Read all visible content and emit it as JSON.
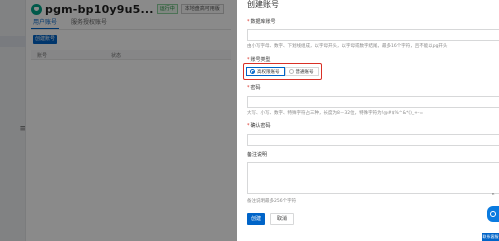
{
  "background": {
    "instance_title": "pgm-bp10y9u5...",
    "status_badge": "运行中",
    "tag_badge": "本地盘高可用版",
    "tabs": [
      {
        "label": "用户账号",
        "active": true
      },
      {
        "label": "服务授权账号",
        "active": false
      }
    ],
    "create_button": "创建账号",
    "table_headers": [
      "账号",
      "状态"
    ],
    "side_glyph": "≡"
  },
  "drawer": {
    "title": "创建账号",
    "account_name": {
      "label": "数据库账号",
      "placeholder": "",
      "help": "由小写字母、数字、下划线组成，以字母开头，以字母或数字结尾，最多16个字符，且不能以pg开头"
    },
    "account_type": {
      "label": "账号类型",
      "options": [
        {
          "label": "高权限账号",
          "selected": true
        },
        {
          "label": "普通账号",
          "selected": false
        }
      ]
    },
    "password": {
      "label": "密码",
      "help": "大写、小写、数字、特殊字符占三种，长度为8－32位，特殊字符为!@#$%^&*()_+-="
    },
    "confirm_password": {
      "label": "确认密码"
    },
    "remark": {
      "label": "备注说明",
      "help": "备注说明最多256个字符"
    },
    "ok_button": "创建",
    "cancel_button": "取消"
  },
  "widgets": {
    "help_label": "联系客服",
    "scroll_mark": "ⁿ"
  },
  "colors": {
    "primary": "#0064c8",
    "highlight_border": "#d93026",
    "brand_green": "#00a58a"
  }
}
